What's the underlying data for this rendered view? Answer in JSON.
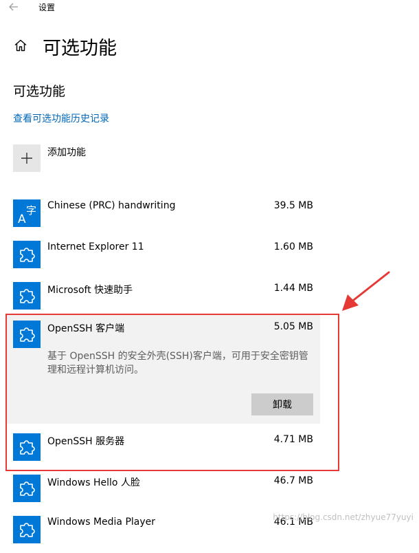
{
  "window": {
    "app_title": "设置"
  },
  "header": {
    "title": "可选功能"
  },
  "section": {
    "title": "可选功能"
  },
  "history_link": "查看可选功能历史记录",
  "add_feature": {
    "label": "添加功能"
  },
  "features": [
    {
      "name": "Chinese (PRC) handwriting",
      "size": "39.5 MB",
      "icon": "language-icon"
    },
    {
      "name": "Internet Explorer 11",
      "size": "1.60 MB",
      "icon": "puzzle-icon"
    },
    {
      "name": "Microsoft 快速助手",
      "size": "1.44 MB",
      "icon": "puzzle-icon"
    },
    {
      "name": "OpenSSH 客户端",
      "size": "5.05 MB",
      "icon": "puzzle-icon",
      "description": "基于 OpenSSH 的安全外壳(SSH)客户端，可用于安全密钥管理和远程计算机访问。",
      "uninstall_label": "卸载"
    },
    {
      "name": "OpenSSH 服务器",
      "size": "4.71 MB",
      "icon": "puzzle-icon"
    },
    {
      "name": "Windows Hello 人脸",
      "size": "46.7 MB",
      "icon": "puzzle-icon"
    },
    {
      "name": "Windows Media Player",
      "size": "46.1 MB",
      "icon": "puzzle-icon"
    }
  ],
  "language_icon_glyphs": {
    "a": "A",
    "zi": "字"
  },
  "watermark": "https://blog.csdn.net/zhyue77yuyi",
  "colors": {
    "accent": "#0078d7",
    "link": "#0067b8",
    "highlight": "#e53935"
  }
}
